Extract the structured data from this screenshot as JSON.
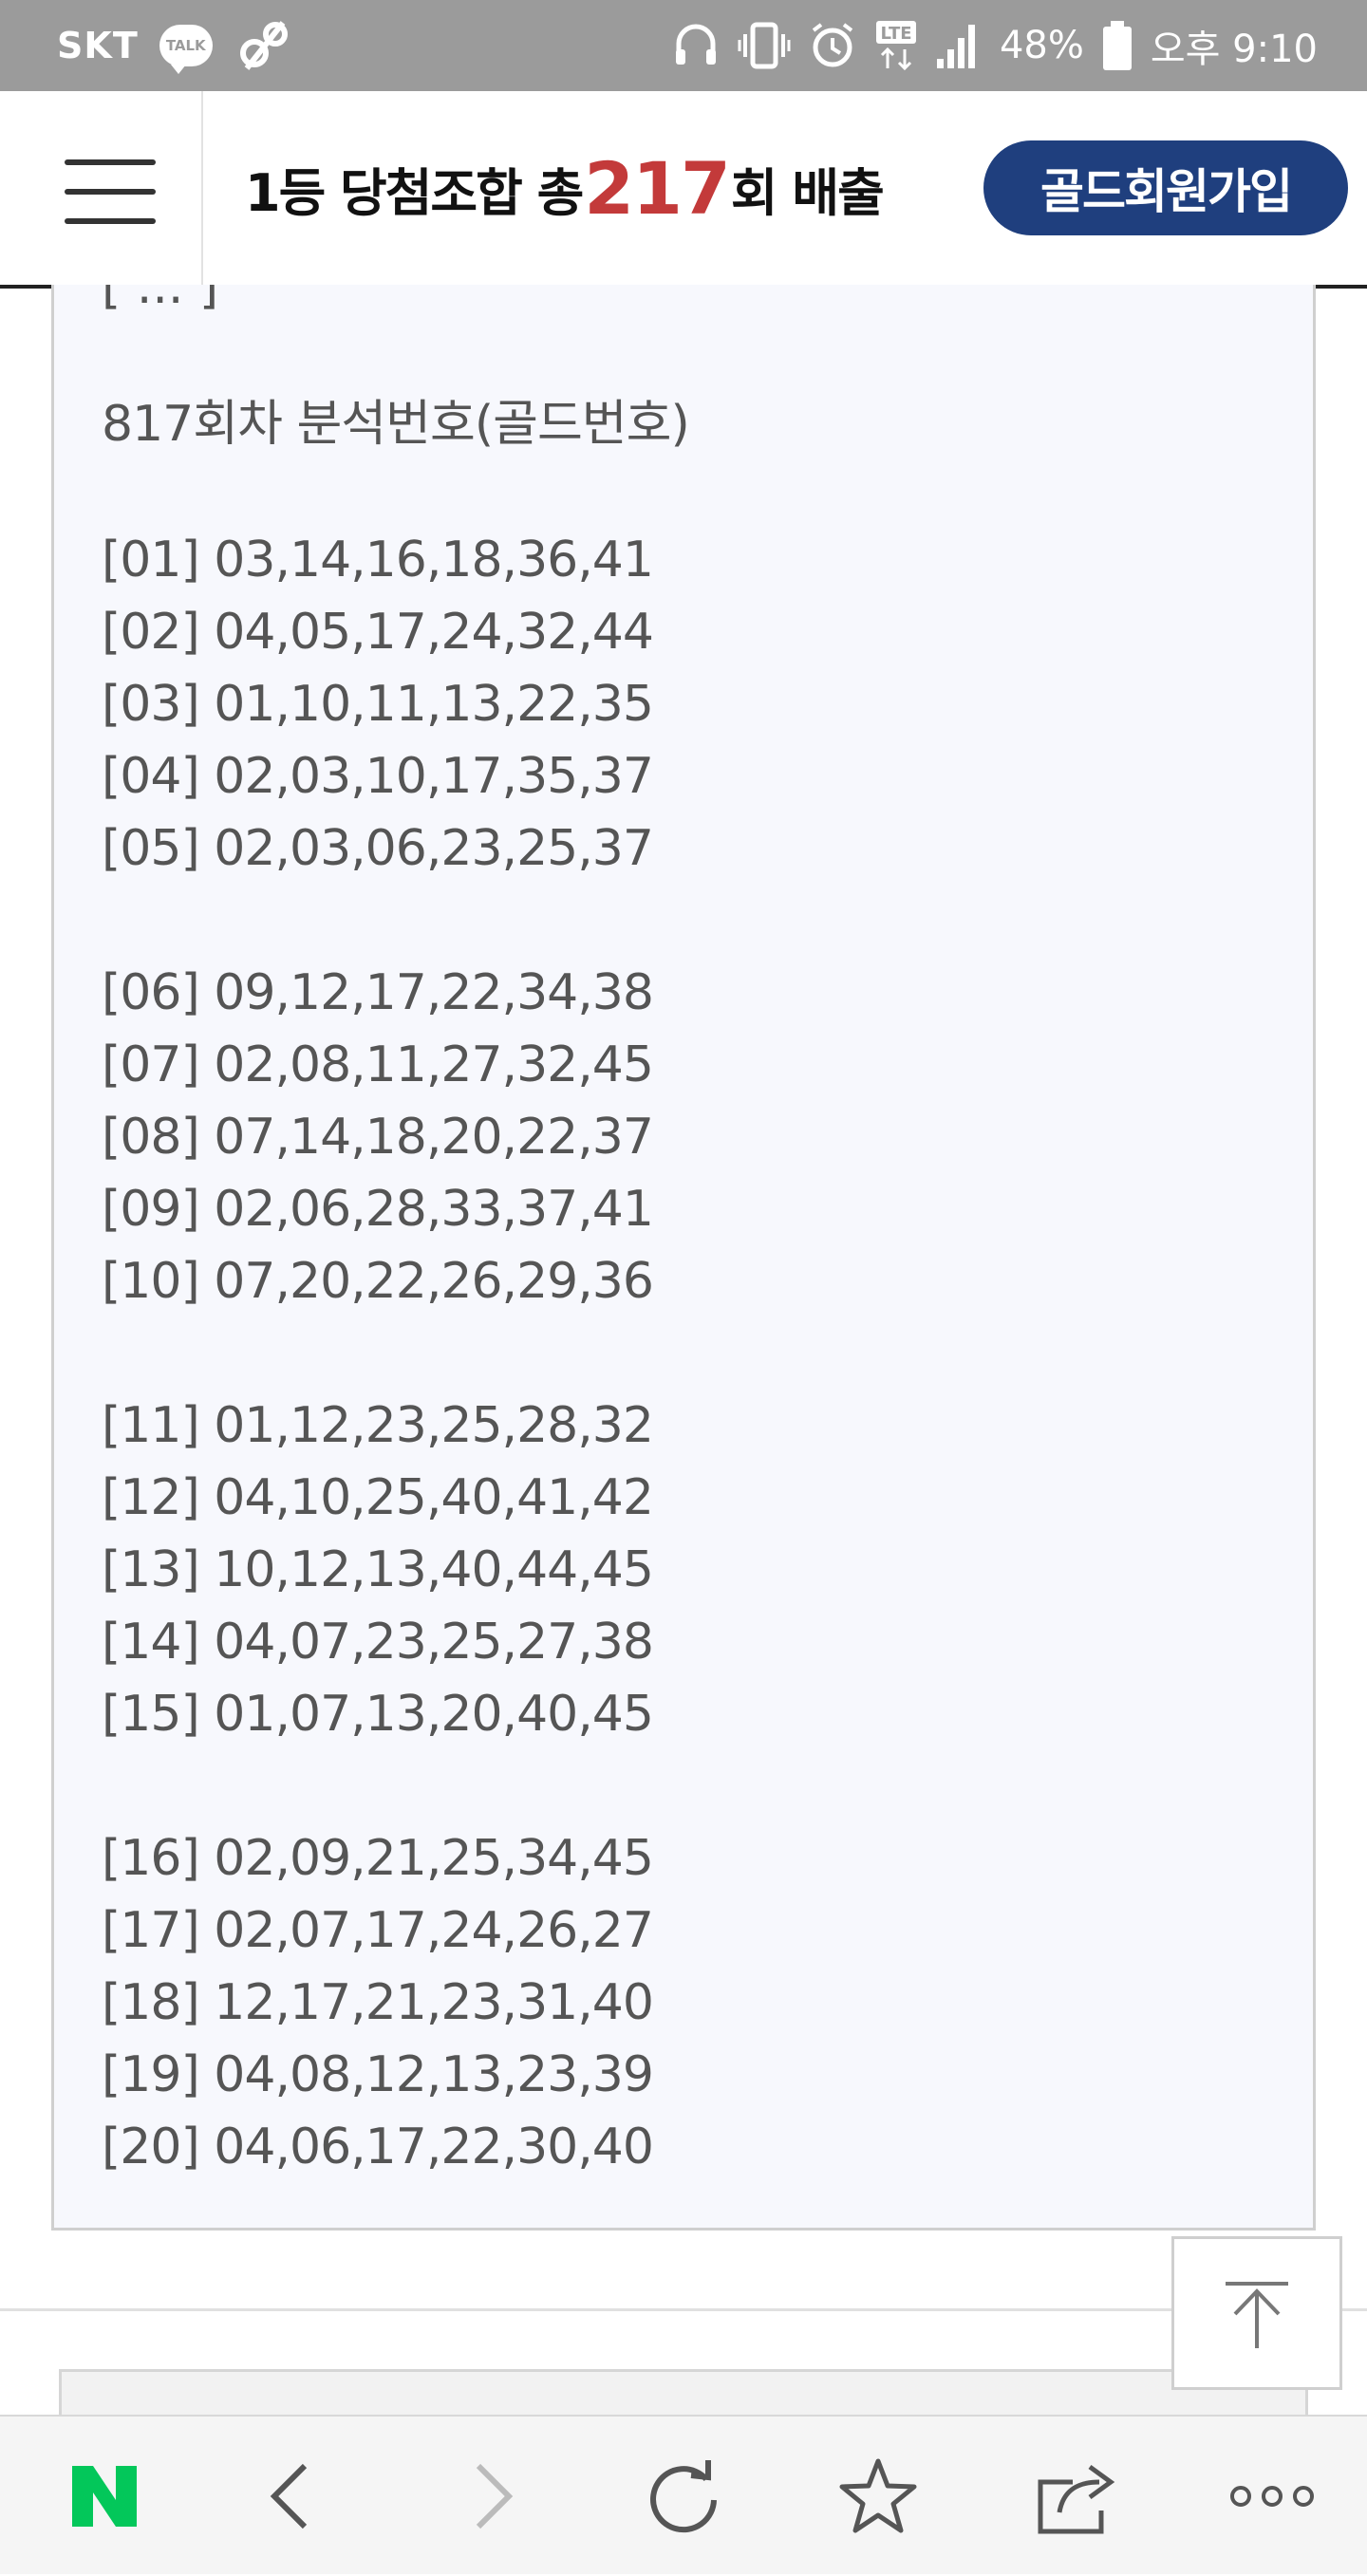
{
  "status_bar": {
    "carrier": "SKT",
    "talk_badge": "TALK",
    "signal_label": "LTE",
    "battery": "48%",
    "time": "오후 9:10"
  },
  "header": {
    "title_prefix": "1등 당첨조합 총 ",
    "title_count": "217",
    "title_suffix": "회 배출",
    "join_button": "골드회원가입",
    "accent_color": "#c33a3a",
    "button_color": "#1f3f7e"
  },
  "content": {
    "partial_line": "[ ... ]",
    "analysis_title": "817회차 분석번호(골드번호)",
    "groups": [
      [
        {
          "label": "[01]",
          "numbers": "03,14,16,18,36,41"
        },
        {
          "label": "[02]",
          "numbers": "04,05,17,24,32,44"
        },
        {
          "label": "[03]",
          "numbers": "01,10,11,13,22,35"
        },
        {
          "label": "[04]",
          "numbers": "02,03,10,17,35,37"
        },
        {
          "label": "[05]",
          "numbers": "02,03,06,23,25,37"
        }
      ],
      [
        {
          "label": "[06]",
          "numbers": "09,12,17,22,34,38"
        },
        {
          "label": "[07]",
          "numbers": "02,08,11,27,32,45"
        },
        {
          "label": "[08]",
          "numbers": "07,14,18,20,22,37"
        },
        {
          "label": "[09]",
          "numbers": "02,06,28,33,37,41"
        },
        {
          "label": "[10]",
          "numbers": "07,20,22,26,29,36"
        }
      ],
      [
        {
          "label": "[11]",
          "numbers": "01,12,23,25,28,32"
        },
        {
          "label": "[12]",
          "numbers": "04,10,25,40,41,42"
        },
        {
          "label": "[13]",
          "numbers": "10,12,13,40,44,45"
        },
        {
          "label": "[14]",
          "numbers": "04,07,23,25,27,38"
        },
        {
          "label": "[15]",
          "numbers": "01,07,13,20,40,45"
        }
      ],
      [
        {
          "label": "[16]",
          "numbers": "02,09,21,25,34,45"
        },
        {
          "label": "[17]",
          "numbers": "02,07,17,24,26,27"
        },
        {
          "label": "[18]",
          "numbers": "12,17,21,23,31,40"
        },
        {
          "label": "[19]",
          "numbers": "04,08,12,13,23,39"
        },
        {
          "label": "[20]",
          "numbers": "04,06,17,22,30,40"
        }
      ]
    ]
  },
  "toolbar": {
    "naver_logo": "N",
    "icons": [
      "naver-home-icon",
      "back-icon",
      "forward-icon",
      "refresh-icon",
      "bookmark-star-icon",
      "share-icon",
      "more-icon"
    ]
  }
}
